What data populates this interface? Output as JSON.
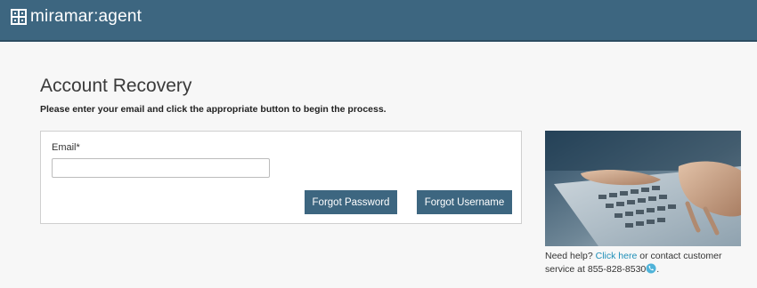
{
  "header": {
    "brand_text": "miramar:agent",
    "logo_icon": "miramar-logo-icon",
    "bg_color": "#3d6680"
  },
  "page": {
    "title": "Account Recovery",
    "subtitle": "Please enter your email and click the appropriate button to begin the process."
  },
  "form": {
    "email_label": "Email",
    "required_marker": "*",
    "email_value": "",
    "email_placeholder": "",
    "forgot_password_label": "Forgot Password",
    "forgot_username_label": "Forgot Username",
    "button_color": "#3d6680"
  },
  "help": {
    "prefix": "Need help? ",
    "link_text": "Click here",
    "middle": " or contact customer service at ",
    "phone": "855-828-8530",
    "suffix": ".",
    "phone_icon": "phone-icon",
    "link_color": "#1f8fb8"
  },
  "photo": {
    "icon": "laptop-typing-photo"
  }
}
